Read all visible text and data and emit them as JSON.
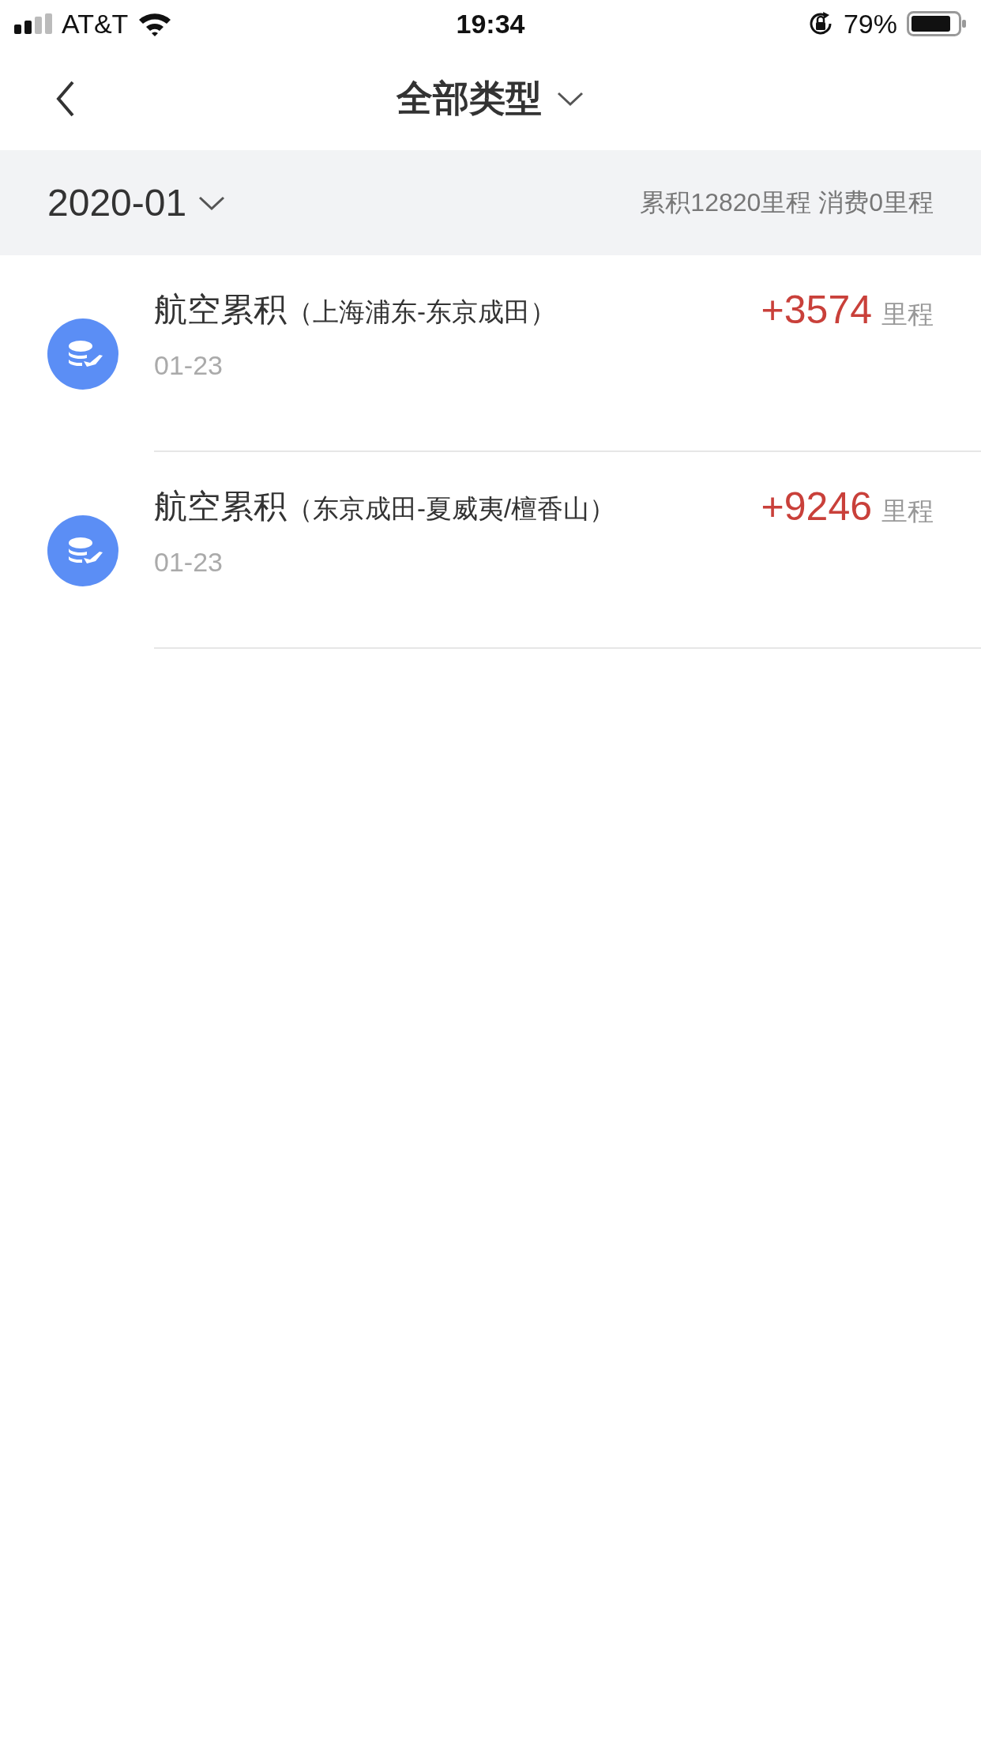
{
  "status_bar": {
    "carrier": "AT&T",
    "time": "19:34",
    "battery": "79%"
  },
  "nav": {
    "title": "全部类型"
  },
  "summary": {
    "month": "2020-01",
    "totals": "累积12820里程 消费0里程"
  },
  "records": [
    {
      "title": "航空累积",
      "route": "（上海浦东-东京成田）",
      "date": "01-23",
      "amount": "+3574",
      "unit": "里程"
    },
    {
      "title": "航空累积",
      "route": "（东京成田-夏威夷/檀香山）",
      "date": "01-23",
      "amount": "+9246",
      "unit": "里程"
    }
  ]
}
